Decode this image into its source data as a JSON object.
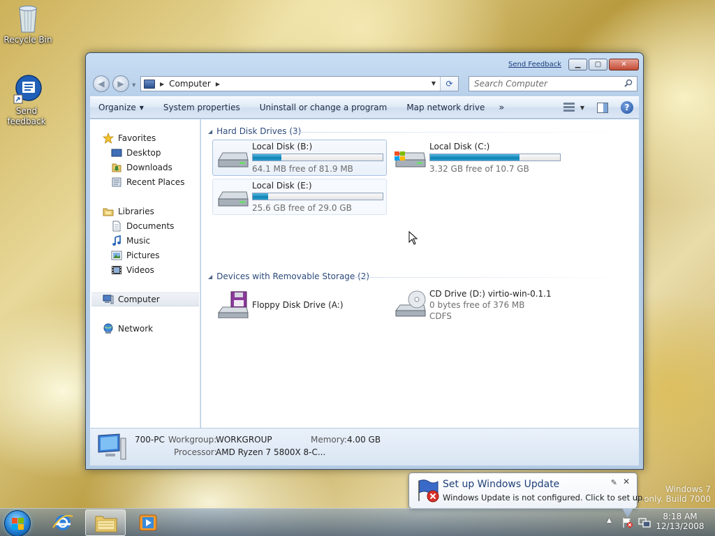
{
  "desktop": {
    "recycle_bin_label": "Recycle Bin",
    "send_feedback_label_1": "Send",
    "send_feedback_label_2": "feedback"
  },
  "window": {
    "send_feedback_link": "Send Feedback",
    "address": {
      "crumb": "Computer"
    },
    "search_placeholder": "Search Computer",
    "toolbar": {
      "organize": "Organize",
      "system_properties": "System properties",
      "uninstall": "Uninstall or change a program",
      "map_network_drive": "Map network drive",
      "more": "»"
    },
    "nav_pane": {
      "favorites": "Favorites",
      "desktop": "Desktop",
      "downloads": "Downloads",
      "recent_places": "Recent Places",
      "libraries": "Libraries",
      "documents": "Documents",
      "music": "Music",
      "pictures": "Pictures",
      "videos": "Videos",
      "computer": "Computer",
      "network": "Network"
    },
    "groups": {
      "hard_disk_drives": "Hard Disk Drives (3)",
      "removable_storage": "Devices with Removable Storage (2)"
    },
    "drives": [
      {
        "name": "Local Disk (B:)",
        "free": "64.1 MB free of 81.9 MB",
        "used_fraction": 0.22
      },
      {
        "name": "Local Disk (C:)",
        "free": "3.32 GB free of 10.7 GB",
        "used_fraction": 0.69
      },
      {
        "name": "Local Disk (E:)",
        "free": "25.6 GB free of 29.0 GB",
        "used_fraction": 0.12
      }
    ],
    "removable": [
      {
        "name": "Floppy Disk Drive (A:)"
      },
      {
        "name": "CD Drive (D:) virtio-win-0.1.1",
        "free": "0 bytes free of 376 MB",
        "fs": "CDFS"
      }
    ],
    "details": {
      "pc_name": "700-PC",
      "workgroup_label": "Workgroup:",
      "workgroup": "WORKGROUP",
      "memory_label": "Memory:",
      "memory": "4.00 GB",
      "processor_label": "Processor:",
      "processor": "AMD Ryzen 7 5800X 8-C..."
    }
  },
  "notification": {
    "title": "Set up Windows Update",
    "message": "Windows Update is not configured. Click to set up."
  },
  "watermark": {
    "line1": "Windows 7",
    "line2": "ses only. Build 7000"
  },
  "taskbar": {
    "time": "8:18 AM",
    "date": "12/13/2008"
  },
  "colors": {
    "progress_fill": "#1e8fc0",
    "window_frame": "#b8d0ea",
    "link": "#1a3c7a"
  }
}
